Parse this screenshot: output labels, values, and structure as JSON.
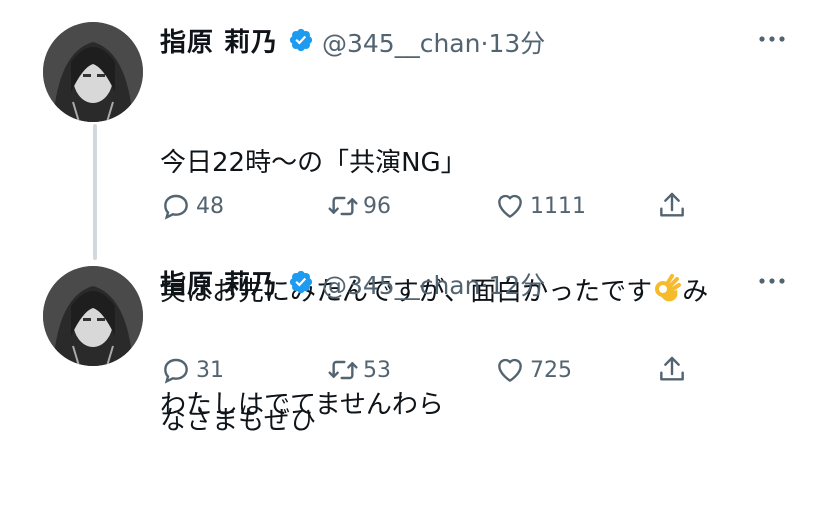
{
  "tweets": [
    {
      "display_name": "指原 莉乃",
      "handle": "@345__chan",
      "separator": "·",
      "time": "13分",
      "text_line1": "今日22時〜の「共演NG」",
      "text_line2_before_emoji": "実はお先にみたんですが、面白かったです",
      "text_line2_after_emoji": "み",
      "text_line3": "なさまもぜひ",
      "emoji": "ok-hand",
      "replies": "48",
      "retweets": "96",
      "likes": "1111"
    },
    {
      "display_name": "指原 莉乃",
      "handle": "@345__chan",
      "separator": "·",
      "time": "12分",
      "text_line1": "わたしはでてませんわら",
      "replies": "31",
      "retweets": "53",
      "likes": "725"
    }
  ],
  "icons": {
    "verified": "verified-badge-icon",
    "more": "more-dots-icon",
    "reply": "reply-icon",
    "retweet": "retweet-icon",
    "like": "heart-icon",
    "share": "share-icon"
  },
  "colors": {
    "verified": "#1d9bf0",
    "secondary_text": "#536471",
    "thread_line": "#cfd9de"
  }
}
